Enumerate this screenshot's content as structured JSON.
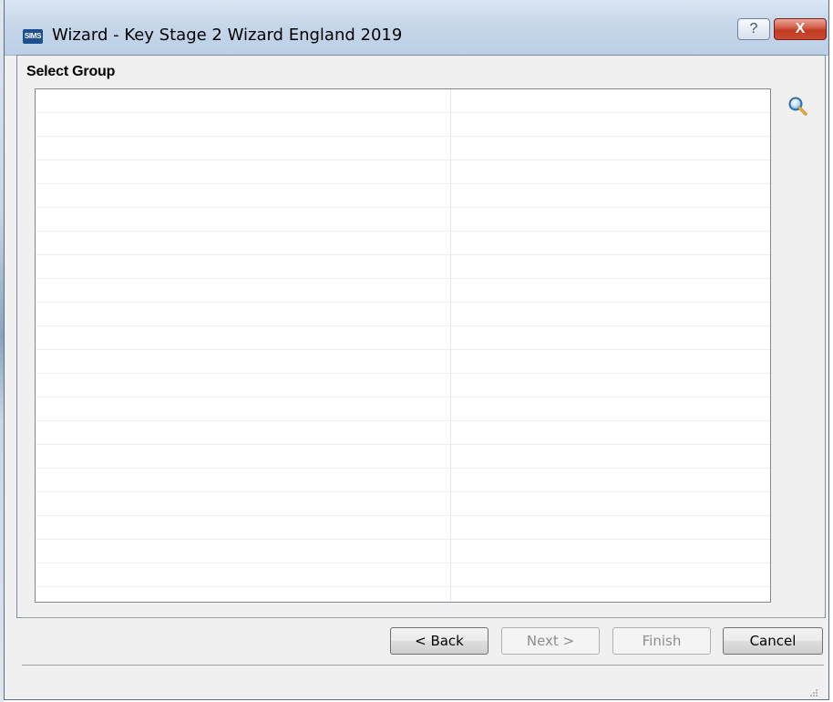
{
  "window": {
    "app_icon_text": "SIMS",
    "title": "Wizard - Key Stage 2 Wizard England 2019",
    "help_glyph": "?",
    "close_glyph": "X"
  },
  "page": {
    "section_title": "Select Group"
  },
  "group_grid": {
    "columns": [
      "",
      ""
    ],
    "rows": []
  },
  "buttons": {
    "back": "< Back",
    "next": "Next >",
    "finish": "Finish",
    "cancel": "Cancel"
  },
  "icons": {
    "search": "search-icon",
    "help": "help-icon",
    "close": "close-icon",
    "resize_grip": "resize-grip-icon"
  },
  "colors": {
    "close_button": "#c9492f",
    "titlebar": "#c7d7ea"
  }
}
